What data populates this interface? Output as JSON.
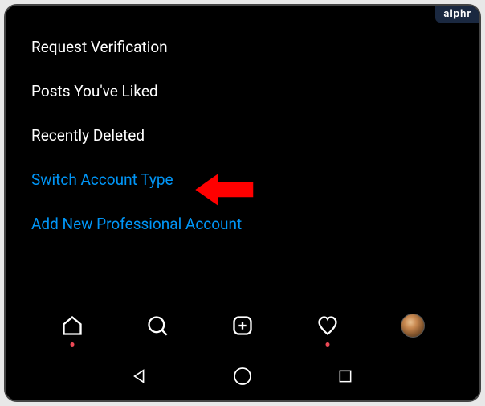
{
  "watermark": "alphr",
  "settings": {
    "items": [
      {
        "label": "Request Verification",
        "style": "white"
      },
      {
        "label": "Posts You've Liked",
        "style": "white"
      },
      {
        "label": "Recently Deleted",
        "style": "white"
      },
      {
        "label": "Switch Account Type",
        "style": "blue"
      },
      {
        "label": "Add New Professional Account",
        "style": "blue"
      }
    ]
  },
  "igNav": {
    "items": [
      {
        "name": "home-icon",
        "hasDot": true
      },
      {
        "name": "search-icon",
        "hasDot": false
      },
      {
        "name": "create-icon",
        "hasDot": false
      },
      {
        "name": "activity-icon",
        "hasDot": true
      },
      {
        "name": "profile-avatar",
        "hasDot": false
      }
    ]
  },
  "systemNav": {
    "items": [
      {
        "name": "back-button"
      },
      {
        "name": "home-button"
      },
      {
        "name": "recents-button"
      }
    ]
  },
  "annotation": {
    "arrow": "red-arrow-pointing-left"
  }
}
